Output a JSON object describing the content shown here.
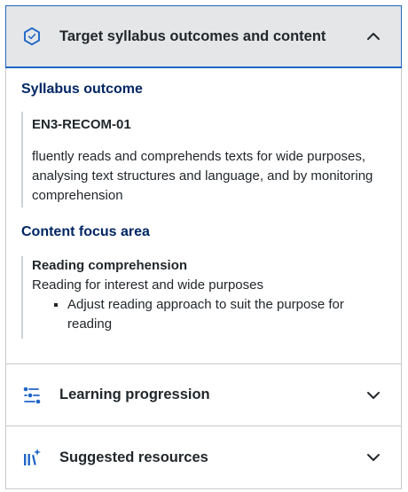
{
  "accordion": {
    "panels": [
      {
        "title": "Target syllabus outcomes and content",
        "icon": "hexagon-check-icon",
        "expanded": true
      },
      {
        "title": "Learning progression",
        "icon": "progression-icon",
        "expanded": false
      },
      {
        "title": "Suggested resources",
        "icon": "library-sparkle-icon",
        "expanded": false
      }
    ]
  },
  "outcome": {
    "heading": "Syllabus outcome",
    "code": "EN3-RECOM-01",
    "description": "fluently reads and comprehends texts for wide purposes, analysing text structures and language, and by monitoring comprehension"
  },
  "focus": {
    "heading": "Content focus area",
    "title": "Reading comprehension",
    "subtitle": "Reading for interest and wide purposes",
    "items": [
      "Adjust reading approach to suit the purpose for reading"
    ]
  },
  "colors": {
    "accent": "#1f66c6",
    "heading": "#002664",
    "header_bg": "#e4e6e8"
  }
}
